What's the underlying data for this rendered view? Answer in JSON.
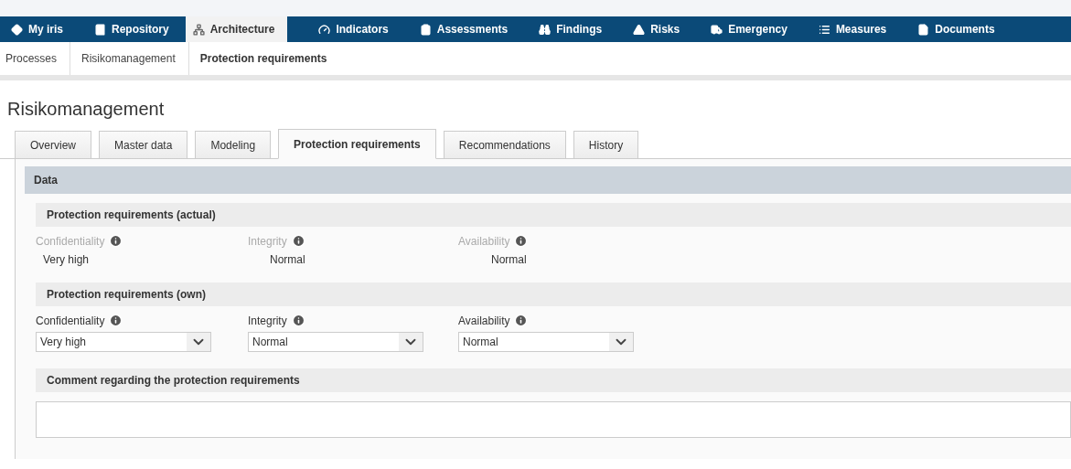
{
  "nav": [
    {
      "label": "My iris",
      "selected": false
    },
    {
      "label": "Repository",
      "selected": false
    },
    {
      "label": "Architecture",
      "selected": true
    },
    {
      "label": "Indicators",
      "selected": false
    },
    {
      "label": "Assessments",
      "selected": false
    },
    {
      "label": "Findings",
      "selected": false
    },
    {
      "label": "Risks",
      "selected": false
    },
    {
      "label": "Emergency",
      "selected": false
    },
    {
      "label": "Measures",
      "selected": false
    },
    {
      "label": "Documents",
      "selected": false
    }
  ],
  "breadcrumb": [
    "Processes",
    "Risikomanagement",
    "Protection requirements"
  ],
  "page_title": "Risikomanagement",
  "tabs": [
    {
      "label": "Overview",
      "selected": false
    },
    {
      "label": "Master data",
      "selected": false
    },
    {
      "label": "Modeling",
      "selected": false
    },
    {
      "label": "Protection requirements",
      "selected": true
    },
    {
      "label": "Recommendations",
      "selected": false
    },
    {
      "label": "History",
      "selected": false
    }
  ],
  "panel": {
    "title": "Data",
    "actual": {
      "title": "Protection requirements (actual)",
      "fields": [
        {
          "label": "Confidentiality",
          "value": "Very high"
        },
        {
          "label": "Integrity",
          "value": "Normal"
        },
        {
          "label": "Availability",
          "value": "Normal"
        }
      ]
    },
    "own": {
      "title": "Protection requirements (own)",
      "fields": [
        {
          "label": "Confidentiality",
          "value": "Very high"
        },
        {
          "label": "Integrity",
          "value": "Normal"
        },
        {
          "label": "Availability",
          "value": "Normal"
        }
      ]
    },
    "comment": {
      "title": "Comment regarding the protection requirements"
    }
  }
}
